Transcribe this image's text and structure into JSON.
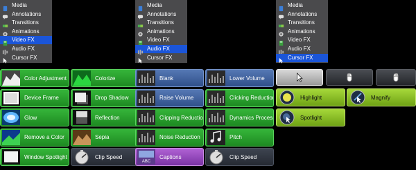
{
  "panels": [
    {
      "items": [
        {
          "label": "Media",
          "icon": "media-icon"
        },
        {
          "label": "Annotations",
          "icon": "annotations-icon"
        },
        {
          "label": "Transitions",
          "icon": "transitions-icon"
        },
        {
          "label": "Animations",
          "icon": "animations-icon"
        },
        {
          "label": "Video FX",
          "icon": "video-fx-icon",
          "selected": true
        },
        {
          "label": "Audio FX",
          "icon": "audio-fx-icon"
        },
        {
          "label": "Cursor FX",
          "icon": "cursor-fx-icon"
        }
      ]
    },
    {
      "items": [
        {
          "label": "Media",
          "icon": "media-icon"
        },
        {
          "label": "Annotations",
          "icon": "annotations-icon"
        },
        {
          "label": "Transitions",
          "icon": "transitions-icon"
        },
        {
          "label": "Animations",
          "icon": "animations-icon"
        },
        {
          "label": "Video FX",
          "icon": "video-fx-icon"
        },
        {
          "label": "Audio FX",
          "icon": "audio-fx-icon",
          "selected": true
        },
        {
          "label": "Cursor FX",
          "icon": "cursor-fx-icon"
        }
      ]
    },
    {
      "items": [
        {
          "label": "Media",
          "icon": "media-icon"
        },
        {
          "label": "Annotations",
          "icon": "annotations-icon"
        },
        {
          "label": "Transitions",
          "icon": "transitions-icon"
        },
        {
          "label": "Animations",
          "icon": "animations-icon"
        },
        {
          "label": "Video FX",
          "icon": "video-fx-icon"
        },
        {
          "label": "Audio FX",
          "icon": "audio-fx-icon"
        },
        {
          "label": "Cursor FX",
          "icon": "cursor-fx-icon",
          "selected": true
        }
      ]
    }
  ],
  "video_fx": [
    {
      "label": "Color Adjustment",
      "color": "green",
      "icon": "color-adjustment-icon"
    },
    {
      "label": "Colorize",
      "color": "green",
      "icon": "colorize-icon"
    },
    {
      "label": "Device Frame",
      "color": "green",
      "icon": "device-frame-icon"
    },
    {
      "label": "Drop Shadow",
      "color": "green",
      "icon": "drop-shadow-icon"
    },
    {
      "label": "Glow",
      "color": "green",
      "icon": "glow-icon"
    },
    {
      "label": "Reflection",
      "color": "green",
      "icon": "reflection-icon"
    },
    {
      "label": "Remove a Color",
      "color": "green",
      "icon": "remove-color-icon"
    },
    {
      "label": "Sepia",
      "color": "green",
      "icon": "sepia-icon"
    },
    {
      "label": "Window Spotlight",
      "color": "green",
      "icon": "window-spotlight-icon"
    },
    {
      "label": "Clip Speed",
      "color": "dark",
      "icon": "clip-speed-icon"
    }
  ],
  "audio_fx": [
    {
      "label": "Blank",
      "color": "blue",
      "icon": "waveform-icon"
    },
    {
      "label": "Lower Volume",
      "color": "blue",
      "icon": "waveform-icon"
    },
    {
      "label": "Raise Volume",
      "color": "blue",
      "icon": "waveform-icon"
    },
    {
      "label": "Clicking Reduction",
      "color": "green",
      "icon": "waveform-icon"
    },
    {
      "label": "Clipping Reduction",
      "color": "green",
      "icon": "waveform-icon"
    },
    {
      "label": "Dynamics Processor",
      "color": "green",
      "icon": "waveform-icon"
    },
    {
      "label": "Noise Reduction",
      "color": "green",
      "icon": "waveform-icon"
    },
    {
      "label": "Pitch",
      "color": "green",
      "icon": "pitch-icon"
    },
    {
      "label": "Captions",
      "color": "purple",
      "icon": "captions-icon",
      "caption_text": "ABC"
    },
    {
      "label": "Clip Speed",
      "color": "dark",
      "icon": "clip-speed-icon"
    }
  ],
  "cursor_fx": {
    "tools": [
      {
        "icon": "arrow-cursor-icon",
        "active": true
      },
      {
        "icon": "mouse-left-click-icon"
      },
      {
        "icon": "mouse-right-click-icon"
      }
    ],
    "effects": [
      {
        "label": "Highlight",
        "color": "lime",
        "icon": "highlight-icon"
      },
      {
        "label": "Magnify",
        "color": "lime",
        "icon": "magnify-icon"
      },
      {
        "label": "Spotlight",
        "color": "lime",
        "icon": "spotlight-icon"
      }
    ]
  }
}
